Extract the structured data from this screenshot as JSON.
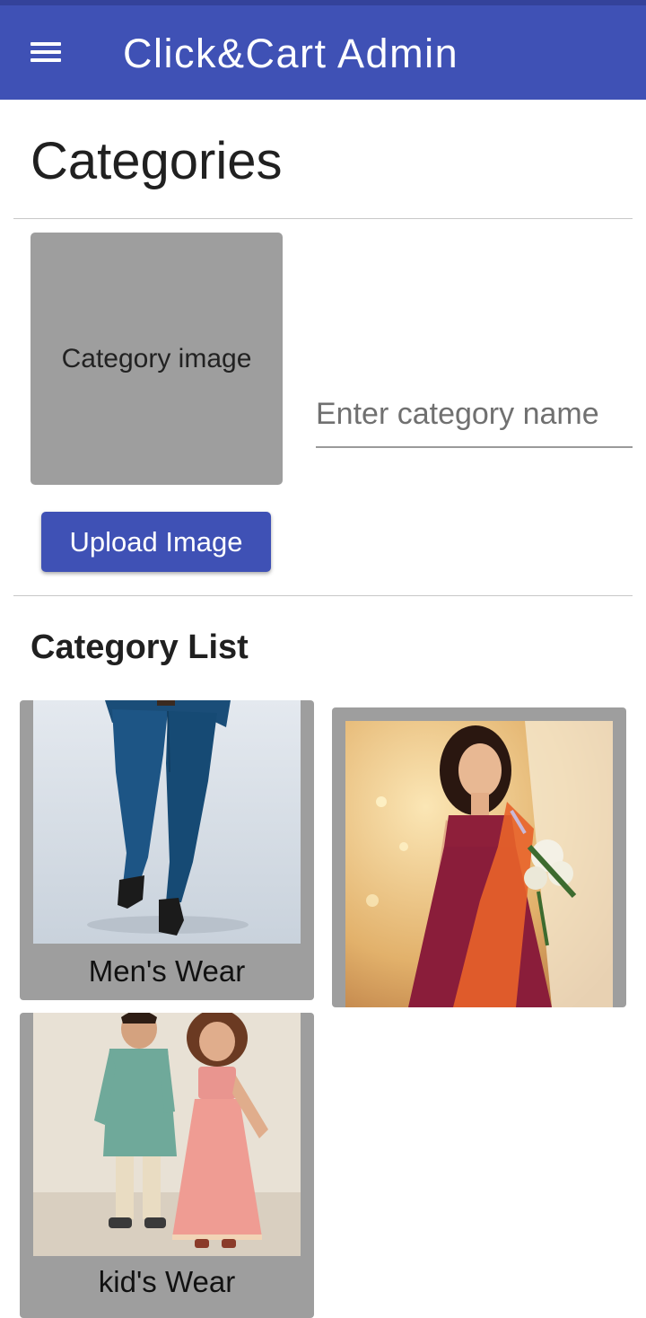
{
  "app_bar": {
    "title": "Click&Cart Admin",
    "menu_icon": "hamburger-menu-icon",
    "color": "#3f51b5"
  },
  "page": {
    "title": "Categories"
  },
  "form": {
    "image_placeholder": "Category image",
    "name_placeholder": "Enter category name",
    "name_value": "",
    "upload_label": "Upload Image"
  },
  "list": {
    "title": "Category List",
    "items": [
      {
        "label": "Men's Wear"
      },
      {
        "label": ""
      },
      {
        "label": "kid's Wear"
      }
    ]
  }
}
